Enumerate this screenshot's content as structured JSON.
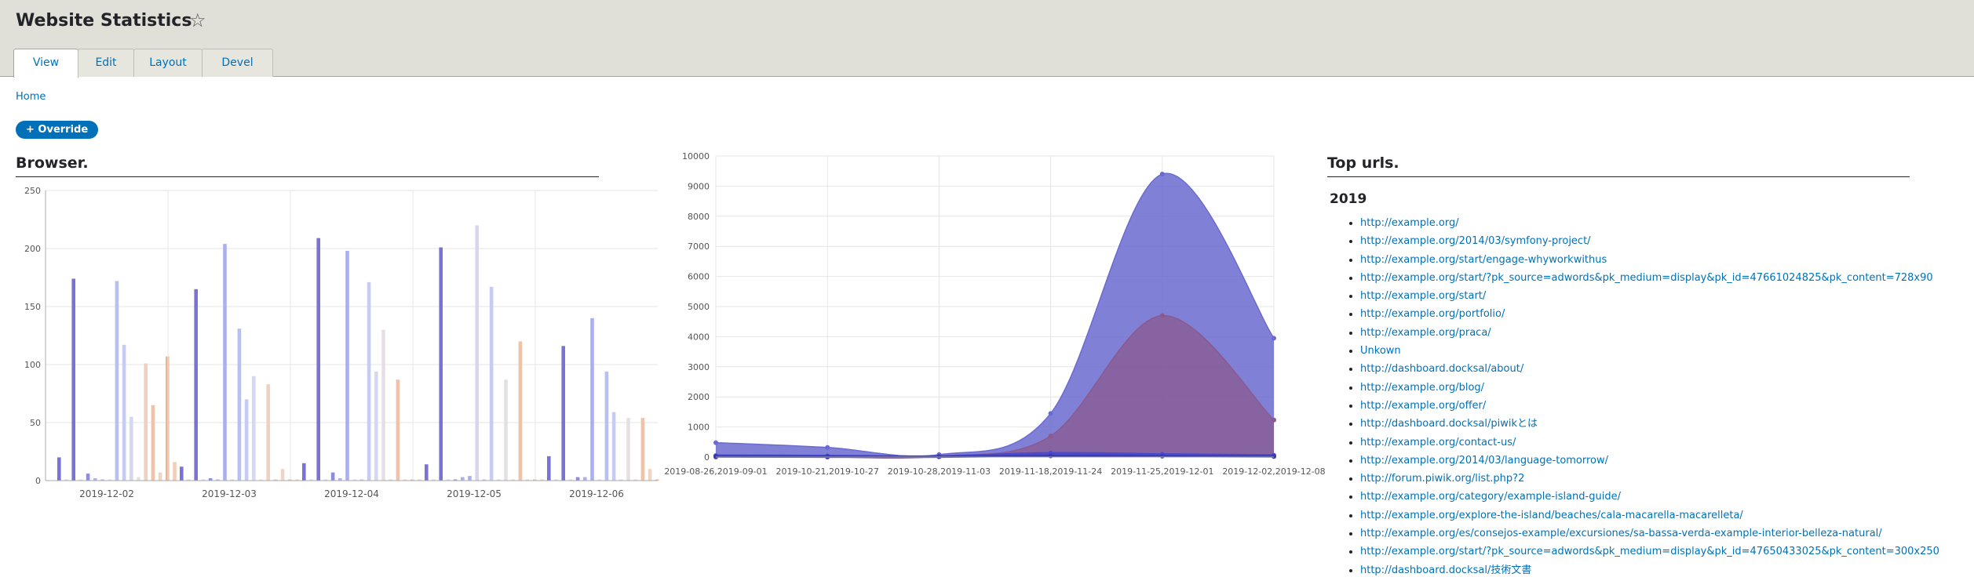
{
  "page": {
    "title": "Website Statistics",
    "star_icon": "star-outline-icon"
  },
  "tabs": [
    {
      "label": "View",
      "active": true
    },
    {
      "label": "Edit",
      "active": false
    },
    {
      "label": "Layout",
      "active": false
    },
    {
      "label": "Devel",
      "active": false
    }
  ],
  "breadcrumb": {
    "home": "Home"
  },
  "override_button": "+ Override",
  "browser_block": {
    "title": "Browser."
  },
  "urls_block": {
    "title": "Top urls.",
    "year": "2019",
    "urls": [
      "http://example.org/",
      "http://example.org/2014/03/symfony-project/",
      "http://example.org/start/engage-whyworkwithus",
      "http://example.org/start/?pk_source=adwords&pk_medium=display&pk_id=47661024825&pk_content=728x90",
      "http://example.org/start/",
      "http://example.org/portfolio/",
      "http://example.org/praca/",
      "Unkown",
      "http://dashboard.docksal/about/",
      "http://example.org/blog/",
      "http://example.org/offer/",
      "http://dashboard.docksal/piwikとは",
      "http://example.org/contact-us/",
      "http://example.org/2014/03/language-tomorrow/",
      "http://forum.piwik.org/list.php?2",
      "http://example.org/category/example-island-guide/",
      "http://example.org/explore-the-island/beaches/cala-macarella-macarelleta/",
      "http://example.org/es/consejos-example/excursiones/sa-bassa-verda-example-interior-belleza-natural/",
      "http://example.org/start/?pk_source=adwords&pk_medium=display&pk_id=47650433025&pk_content=300x250",
      "http://dashboard.docksal/技術文書"
    ]
  },
  "colors": {
    "link": "#0071b8",
    "area_primary": "#6a6ad0",
    "area_secondary": "#8a5a8f"
  },
  "chart_data": [
    {
      "type": "bar",
      "title": "",
      "categories": [
        "2019-12-02",
        "2019-12-03",
        "2019-12-04",
        "2019-12-05",
        "2019-12-06"
      ],
      "ylim": [
        0,
        250
      ],
      "yticks": [
        0,
        50,
        100,
        150,
        200,
        250
      ],
      "grid": true,
      "series": [
        {
          "color": "#7b72d6",
          "values": [
            20,
            12,
            15,
            14,
            21
          ]
        },
        {
          "color": "#d8d4f2",
          "values": [
            1,
            1,
            1,
            1,
            1
          ]
        },
        {
          "color": "#7b72d6",
          "values": [
            174,
            165,
            209,
            201,
            116
          ]
        },
        {
          "color": "#d8d4f2",
          "values": [
            1,
            1,
            1,
            1,
            1
          ]
        },
        {
          "color": "#8c8ce0",
          "values": [
            6,
            2,
            7,
            1,
            3
          ]
        },
        {
          "color": "#aab0ec",
          "values": [
            2,
            1,
            2,
            3,
            3
          ]
        },
        {
          "color": "#aab0ec",
          "values": [
            1,
            204,
            198,
            4,
            140
          ]
        },
        {
          "color": "#d8d4f2",
          "values": [
            1,
            1,
            1,
            220,
            1
          ]
        },
        {
          "color": "#b9c0f0",
          "values": [
            172,
            131,
            1,
            1,
            94
          ]
        },
        {
          "color": "#c6ccf2",
          "values": [
            117,
            70,
            171,
            167,
            59
          ]
        },
        {
          "color": "#d4d8f4",
          "values": [
            55,
            90,
            94,
            1,
            1
          ]
        },
        {
          "color": "#e4dfe4",
          "values": [
            3,
            1,
            130,
            87,
            54
          ]
        },
        {
          "color": "#f1d0bd",
          "values": [
            101,
            83,
            1,
            1,
            1
          ]
        },
        {
          "color": "#f0c2a8",
          "values": [
            65,
            1,
            87,
            120,
            54
          ]
        },
        {
          "color": "#efd5c5",
          "values": [
            7,
            10,
            1,
            1,
            10
          ]
        },
        {
          "color": "#f0b48e",
          "values": [
            107,
            1,
            1,
            1,
            1
          ]
        },
        {
          "color": "#f3cdb6",
          "values": [
            16,
            1,
            1,
            1,
            1
          ]
        }
      ]
    },
    {
      "type": "area",
      "title": "",
      "categories": [
        "2019-08-26,2019-09-01",
        "2019-10-21,2019-10-27",
        "2019-10-28,2019-11-03",
        "2019-11-18,2019-11-24",
        "2019-11-25,2019-12-01",
        "2019-12-02,2019-12-08"
      ],
      "ylim": [
        0,
        10000
      ],
      "yticks": [
        0,
        1000,
        2000,
        3000,
        4000,
        5000,
        6000,
        7000,
        8000,
        9000,
        10000
      ],
      "grid": true,
      "series": [
        {
          "color": "#6a6ad0",
          "values": [
            480,
            320,
            80,
            1450,
            9400,
            3950
          ]
        },
        {
          "color": "#8a5a8f",
          "values": [
            0,
            0,
            30,
            700,
            4700,
            1230
          ]
        },
        {
          "color": "#4a4ad0",
          "values": [
            50,
            40,
            20,
            130,
            90,
            60
          ]
        },
        {
          "color": "#3a3ab0",
          "values": [
            20,
            10,
            10,
            40,
            30,
            20
          ]
        }
      ]
    }
  ]
}
